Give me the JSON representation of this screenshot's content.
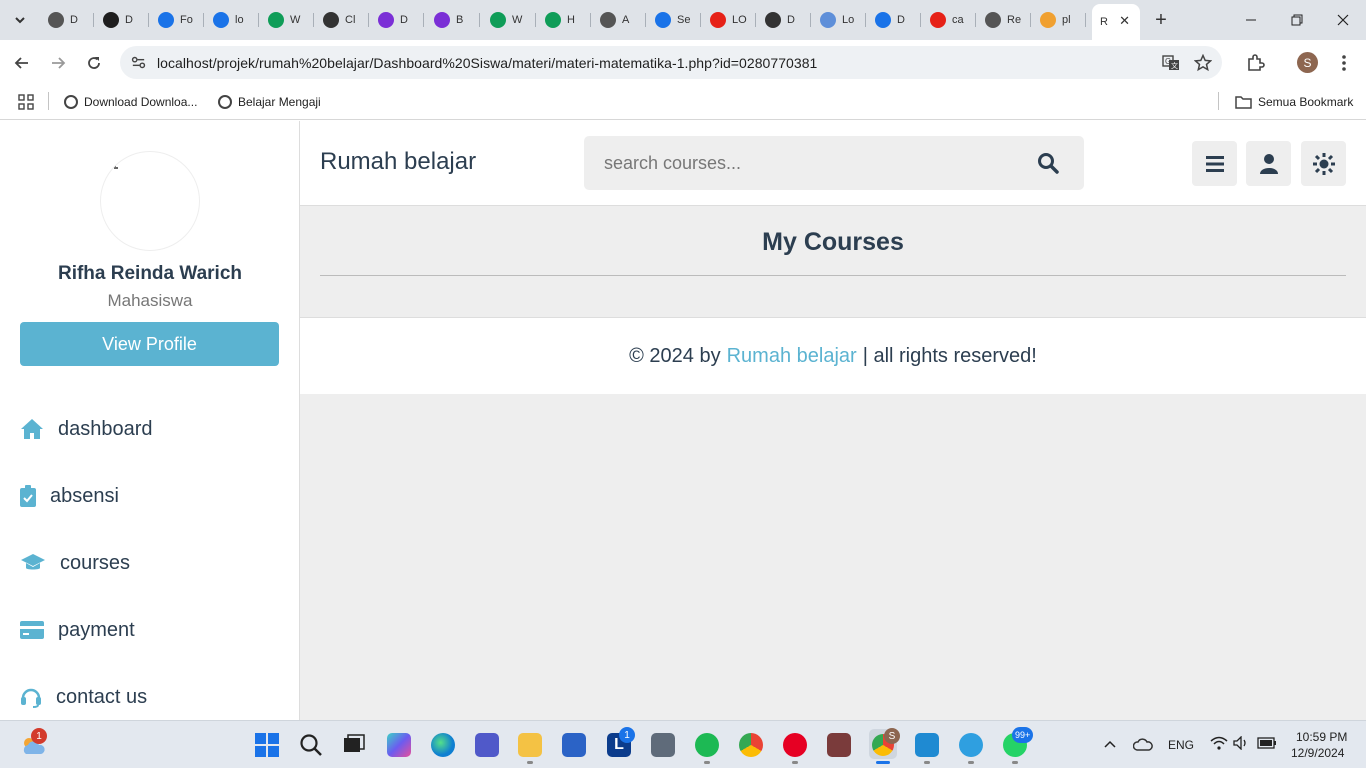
{
  "browser": {
    "tabs": [
      {
        "label": "D",
        "favicon": "globe-icon",
        "color": "#555555"
      },
      {
        "label": "D",
        "favicon": "bolt-icon",
        "color": "#1e1e1e"
      },
      {
        "label": "Fo",
        "favicon": "people-icon",
        "color": "#1a73e8"
      },
      {
        "label": "lo",
        "favicon": "link-icon",
        "color": "#1a73e8"
      },
      {
        "label": "W",
        "favicon": "w-icon",
        "color": "#0f9d58"
      },
      {
        "label": "Cl",
        "favicon": "cup-icon",
        "color": "#333333"
      },
      {
        "label": "D",
        "favicon": "b-icon",
        "color": "#7b2fd6"
      },
      {
        "label": "B",
        "favicon": "b-icon",
        "color": "#7b2fd6"
      },
      {
        "label": "W",
        "favicon": "w-icon",
        "color": "#0f9d58"
      },
      {
        "label": "H",
        "favicon": "w-icon",
        "color": "#0f9d58"
      },
      {
        "label": "A",
        "favicon": "globe-icon",
        "color": "#555555"
      },
      {
        "label": "Se",
        "favicon": "gear-icon",
        "color": "#1a73e8"
      },
      {
        "label": "LO",
        "favicon": "youtube-icon",
        "color": "#e62117"
      },
      {
        "label": "D",
        "favicon": "openai-icon",
        "color": "#333333"
      },
      {
        "label": "Lo",
        "favicon": "chart-icon",
        "color": "#5e8fd9"
      },
      {
        "label": "D",
        "favicon": "nodes-icon",
        "color": "#1a73e8"
      },
      {
        "label": "ca",
        "favicon": "youtube-icon",
        "color": "#e62117"
      },
      {
        "label": "Re",
        "favicon": "globe-icon",
        "color": "#555555"
      },
      {
        "label": "pl",
        "favicon": "pma-icon",
        "color": "#f0a030"
      },
      {
        "label": "R",
        "favicon": "none",
        "color": "#ffffff",
        "active": true
      }
    ],
    "url": "localhost/projek/rumah%20belajar/Dashboard%20Siswa/materi/materi-matematika-1.php?id=0280770381",
    "profile_initial": "S",
    "bookmarks": [
      {
        "label": "Download Downloa..."
      },
      {
        "label": "Belajar Mengaji"
      }
    ],
    "all_bookmarks_label": "Semua Bookmark"
  },
  "sidebar": {
    "user_name": "Rifha Reinda Warich",
    "user_role": "Mahasiswa",
    "view_profile_label": "View Profile",
    "nav": [
      {
        "label": "dashboard",
        "icon": "home-icon"
      },
      {
        "label": "absensi",
        "icon": "clipboard-check-icon"
      },
      {
        "label": "courses",
        "icon": "graduation-cap-icon"
      },
      {
        "label": "payment",
        "icon": "credit-card-icon"
      },
      {
        "label": "contact us",
        "icon": "headset-icon"
      }
    ]
  },
  "header": {
    "brand": "Rumah belajar",
    "search_placeholder": "search courses..."
  },
  "main": {
    "section_title": "My Courses"
  },
  "footer": {
    "prefix": "© 2024 by",
    "brand": "Rumah belajar",
    "suffix": "| all rights reserved!"
  },
  "colors": {
    "accent": "#5bb3d1",
    "text_dark": "#2c3e50",
    "content_bg": "#eeeeee"
  },
  "taskbar": {
    "weather_badge": "1",
    "outlook_badge": "1",
    "whatsapp_badge": "99+",
    "chrome_profile_badge": "S",
    "language": "ENG",
    "time": "10:59 PM",
    "date": "12/9/2024"
  }
}
